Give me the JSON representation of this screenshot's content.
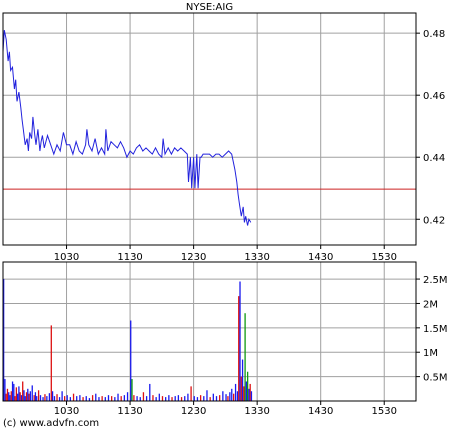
{
  "source": "(c) www.advfn.com",
  "colors": {
    "price_line": "#2222dd",
    "ref_line": "#cc2020",
    "grid": "#a0a0a0",
    "frame": "#000000",
    "vol_up": "#1a1aee",
    "vol_down": "#dd1111",
    "vol_neutral": "#119911"
  },
  "chart_data": [
    {
      "type": "line",
      "title": "NYSE:AIG",
      "x_tick_labels": [
        "1030",
        "1130",
        "1230",
        "1330",
        "1430",
        "1530"
      ],
      "x_ticks": [
        10.5,
        11.5,
        12.5,
        13.5,
        14.5,
        15.5
      ],
      "xlim": [
        9.5,
        16.0
      ],
      "ylim": [
        0.4117,
        0.4865
      ],
      "y_ticks": [
        0.42,
        0.44,
        0.46,
        0.48
      ],
      "y_tick_labels": [
        "0.42",
        "0.44",
        "0.46",
        "0.48"
      ],
      "grid": true,
      "reference_line": 0.4297,
      "series": [
        {
          "x": [
            9.5,
            9.52,
            9.55,
            9.58,
            9.6,
            9.62,
            9.65,
            9.68,
            9.7,
            9.72,
            9.75,
            9.78,
            9.8,
            9.82,
            9.85,
            9.88,
            9.9,
            9.92,
            9.95,
            9.97,
            10.0,
            10.02,
            10.05,
            10.08,
            10.1,
            10.12,
            10.15,
            10.2,
            10.25,
            10.3,
            10.35,
            10.4,
            10.45,
            10.5,
            10.55,
            10.6,
            10.65,
            10.7,
            10.75,
            10.8,
            10.82,
            10.85,
            10.9,
            10.95,
            11.0,
            11.05,
            11.1,
            11.12,
            11.15,
            11.2,
            11.25,
            11.3,
            11.35,
            11.4,
            11.45,
            11.5,
            11.55,
            11.6,
            11.65,
            11.7,
            11.75,
            11.8,
            11.85,
            11.9,
            11.95,
            12.0,
            12.02,
            12.05,
            12.1,
            12.15,
            12.2,
            12.25,
            12.3,
            12.35,
            12.4,
            12.42,
            12.45,
            12.47,
            12.5,
            12.52,
            12.55,
            12.57,
            12.6,
            12.62,
            12.65,
            12.7,
            12.75,
            12.8,
            12.85,
            12.9,
            12.95,
            13.0,
            13.05,
            13.1,
            13.15,
            13.18,
            13.2,
            13.22,
            13.25,
            13.28,
            13.3,
            13.32,
            13.35,
            13.37,
            13.4
          ],
          "y": [
            0.474,
            0.481,
            0.478,
            0.471,
            0.474,
            0.468,
            0.469,
            0.462,
            0.465,
            0.458,
            0.461,
            0.456,
            0.452,
            0.449,
            0.444,
            0.446,
            0.442,
            0.448,
            0.446,
            0.453,
            0.447,
            0.444,
            0.449,
            0.442,
            0.445,
            0.447,
            0.443,
            0.447,
            0.444,
            0.441,
            0.444,
            0.442,
            0.448,
            0.444,
            0.444,
            0.441,
            0.445,
            0.442,
            0.441,
            0.444,
            0.449,
            0.444,
            0.442,
            0.446,
            0.441,
            0.443,
            0.441,
            0.449,
            0.442,
            0.445,
            0.444,
            0.443,
            0.445,
            0.443,
            0.44,
            0.442,
            0.441,
            0.443,
            0.444,
            0.442,
            0.443,
            0.442,
            0.441,
            0.443,
            0.441,
            0.44,
            0.446,
            0.441,
            0.443,
            0.441,
            0.443,
            0.442,
            0.443,
            0.442,
            0.441,
            0.432,
            0.44,
            0.43,
            0.44,
            0.43,
            0.441,
            0.43,
            0.44,
            0.44,
            0.441,
            0.441,
            0.441,
            0.44,
            0.441,
            0.441,
            0.44,
            0.441,
            0.442,
            0.441,
            0.436,
            0.432,
            0.428,
            0.425,
            0.421,
            0.424,
            0.419,
            0.421,
            0.418,
            0.42,
            0.419
          ]
        }
      ]
    },
    {
      "type": "bar",
      "x_tick_labels": [
        "1030",
        "1130",
        "1230",
        "1330",
        "1430",
        "1530"
      ],
      "x_ticks": [
        10.5,
        11.5,
        12.5,
        13.5,
        14.5,
        15.5
      ],
      "xlim": [
        9.5,
        16.0
      ],
      "ylim": [
        0,
        2.85
      ],
      "y_ticks": [
        0.5,
        1.0,
        1.5,
        2.0,
        2.5
      ],
      "y_tick_labels": [
        "0.5M",
        "1M",
        "1.5M",
        "2M",
        "2.5M"
      ],
      "grid": true,
      "bars": [
        {
          "x": 9.5,
          "v": 2.5,
          "c": "vol_up"
        },
        {
          "x": 9.52,
          "v": 0.45,
          "c": "vol_up"
        },
        {
          "x": 9.54,
          "v": 0.15,
          "c": "vol_down"
        },
        {
          "x": 9.56,
          "v": 0.25,
          "c": "vol_down"
        },
        {
          "x": 9.58,
          "v": 0.18,
          "c": "vol_up"
        },
        {
          "x": 9.6,
          "v": 0.12,
          "c": "vol_up"
        },
        {
          "x": 9.62,
          "v": 0.2,
          "c": "vol_down"
        },
        {
          "x": 9.64,
          "v": 0.4,
          "c": "vol_up"
        },
        {
          "x": 9.66,
          "v": 0.35,
          "c": "vol_up"
        },
        {
          "x": 9.68,
          "v": 0.1,
          "c": "vol_down"
        },
        {
          "x": 9.7,
          "v": 0.28,
          "c": "vol_down"
        },
        {
          "x": 9.72,
          "v": 0.15,
          "c": "vol_up"
        },
        {
          "x": 9.74,
          "v": 0.3,
          "c": "vol_up"
        },
        {
          "x": 9.76,
          "v": 0.18,
          "c": "vol_down"
        },
        {
          "x": 9.78,
          "v": 0.12,
          "c": "vol_up"
        },
        {
          "x": 9.8,
          "v": 0.4,
          "c": "vol_down"
        },
        {
          "x": 9.82,
          "v": 0.22,
          "c": "vol_up"
        },
        {
          "x": 9.84,
          "v": 0.1,
          "c": "vol_up"
        },
        {
          "x": 9.86,
          "v": 0.18,
          "c": "vol_down"
        },
        {
          "x": 9.88,
          "v": 0.25,
          "c": "vol_up"
        },
        {
          "x": 9.9,
          "v": 0.15,
          "c": "vol_down"
        },
        {
          "x": 9.92,
          "v": 0.2,
          "c": "vol_up"
        },
        {
          "x": 9.95,
          "v": 0.32,
          "c": "vol_up"
        },
        {
          "x": 9.98,
          "v": 0.12,
          "c": "vol_down"
        },
        {
          "x": 10.0,
          "v": 0.18,
          "c": "vol_up"
        },
        {
          "x": 10.02,
          "v": 0.1,
          "c": "vol_up"
        },
        {
          "x": 10.05,
          "v": 0.22,
          "c": "vol_down"
        },
        {
          "x": 10.08,
          "v": 0.12,
          "c": "vol_up"
        },
        {
          "x": 10.12,
          "v": 0.08,
          "c": "vol_up"
        },
        {
          "x": 10.15,
          "v": 0.14,
          "c": "vol_down"
        },
        {
          "x": 10.18,
          "v": 0.1,
          "c": "vol_up"
        },
        {
          "x": 10.22,
          "v": 0.16,
          "c": "vol_up"
        },
        {
          "x": 10.25,
          "v": 1.55,
          "c": "vol_down"
        },
        {
          "x": 10.27,
          "v": 0.2,
          "c": "vol_up"
        },
        {
          "x": 10.3,
          "v": 0.1,
          "c": "vol_up"
        },
        {
          "x": 10.34,
          "v": 0.14,
          "c": "vol_down"
        },
        {
          "x": 10.38,
          "v": 0.08,
          "c": "vol_up"
        },
        {
          "x": 10.42,
          "v": 0.2,
          "c": "vol_up"
        },
        {
          "x": 10.46,
          "v": 0.1,
          "c": "vol_down"
        },
        {
          "x": 10.5,
          "v": 0.12,
          "c": "vol_up"
        },
        {
          "x": 10.55,
          "v": 0.08,
          "c": "vol_up"
        },
        {
          "x": 10.6,
          "v": 0.15,
          "c": "vol_down"
        },
        {
          "x": 10.65,
          "v": 0.1,
          "c": "vol_up"
        },
        {
          "x": 10.7,
          "v": 0.12,
          "c": "vol_up"
        },
        {
          "x": 10.75,
          "v": 0.08,
          "c": "vol_down"
        },
        {
          "x": 10.8,
          "v": 0.1,
          "c": "vol_up"
        },
        {
          "x": 10.85,
          "v": 0.06,
          "c": "vol_up"
        },
        {
          "x": 10.9,
          "v": 0.12,
          "c": "vol_down"
        },
        {
          "x": 10.95,
          "v": 0.15,
          "c": "vol_up"
        },
        {
          "x": 11.0,
          "v": 0.08,
          "c": "vol_up"
        },
        {
          "x": 11.05,
          "v": 0.1,
          "c": "vol_down"
        },
        {
          "x": 11.1,
          "v": 0.08,
          "c": "vol_up"
        },
        {
          "x": 11.15,
          "v": 0.12,
          "c": "vol_up"
        },
        {
          "x": 11.2,
          "v": 0.1,
          "c": "vol_down"
        },
        {
          "x": 11.25,
          "v": 0.08,
          "c": "vol_up"
        },
        {
          "x": 11.3,
          "v": 0.15,
          "c": "vol_up"
        },
        {
          "x": 11.35,
          "v": 0.1,
          "c": "vol_down"
        },
        {
          "x": 11.4,
          "v": 0.12,
          "c": "vol_up"
        },
        {
          "x": 11.45,
          "v": 0.18,
          "c": "vol_up"
        },
        {
          "x": 11.5,
          "v": 1.65,
          "c": "vol_up"
        },
        {
          "x": 11.52,
          "v": 0.45,
          "c": "vol_neutral"
        },
        {
          "x": 11.55,
          "v": 0.12,
          "c": "vol_down"
        },
        {
          "x": 11.6,
          "v": 0.1,
          "c": "vol_up"
        },
        {
          "x": 11.65,
          "v": 0.08,
          "c": "vol_up"
        },
        {
          "x": 11.7,
          "v": 0.18,
          "c": "vol_down"
        },
        {
          "x": 11.75,
          "v": 0.1,
          "c": "vol_up"
        },
        {
          "x": 11.8,
          "v": 0.35,
          "c": "vol_up"
        },
        {
          "x": 11.85,
          "v": 0.12,
          "c": "vol_down"
        },
        {
          "x": 11.9,
          "v": 0.08,
          "c": "vol_up"
        },
        {
          "x": 11.95,
          "v": 0.15,
          "c": "vol_up"
        },
        {
          "x": 12.0,
          "v": 0.1,
          "c": "vol_down"
        },
        {
          "x": 12.05,
          "v": 0.08,
          "c": "vol_up"
        },
        {
          "x": 12.1,
          "v": 0.12,
          "c": "vol_up"
        },
        {
          "x": 12.15,
          "v": 0.08,
          "c": "vol_down"
        },
        {
          "x": 12.2,
          "v": 0.1,
          "c": "vol_up"
        },
        {
          "x": 12.25,
          "v": 0.12,
          "c": "vol_up"
        },
        {
          "x": 12.3,
          "v": 0.08,
          "c": "vol_down"
        },
        {
          "x": 12.35,
          "v": 0.1,
          "c": "vol_up"
        },
        {
          "x": 12.4,
          "v": 0.15,
          "c": "vol_up"
        },
        {
          "x": 12.45,
          "v": 0.3,
          "c": "vol_down"
        },
        {
          "x": 12.5,
          "v": 0.1,
          "c": "vol_up"
        },
        {
          "x": 12.55,
          "v": 0.08,
          "c": "vol_up"
        },
        {
          "x": 12.6,
          "v": 0.12,
          "c": "vol_down"
        },
        {
          "x": 12.65,
          "v": 0.1,
          "c": "vol_up"
        },
        {
          "x": 12.7,
          "v": 0.22,
          "c": "vol_up"
        },
        {
          "x": 12.75,
          "v": 0.08,
          "c": "vol_down"
        },
        {
          "x": 12.8,
          "v": 0.15,
          "c": "vol_up"
        },
        {
          "x": 12.85,
          "v": 0.1,
          "c": "vol_up"
        },
        {
          "x": 12.9,
          "v": 0.12,
          "c": "vol_down"
        },
        {
          "x": 12.95,
          "v": 0.2,
          "c": "vol_up"
        },
        {
          "x": 13.0,
          "v": 0.14,
          "c": "vol_up"
        },
        {
          "x": 13.03,
          "v": 0.1,
          "c": "vol_down"
        },
        {
          "x": 13.06,
          "v": 0.18,
          "c": "vol_up"
        },
        {
          "x": 13.09,
          "v": 0.25,
          "c": "vol_up"
        },
        {
          "x": 13.12,
          "v": 0.15,
          "c": "vol_down"
        },
        {
          "x": 13.15,
          "v": 0.35,
          "c": "vol_up"
        },
        {
          "x": 13.18,
          "v": 0.2,
          "c": "vol_up"
        },
        {
          "x": 13.2,
          "v": 2.15,
          "c": "vol_down"
        },
        {
          "x": 13.22,
          "v": 2.45,
          "c": "vol_up"
        },
        {
          "x": 13.24,
          "v": 0.5,
          "c": "vol_down"
        },
        {
          "x": 13.26,
          "v": 0.85,
          "c": "vol_up"
        },
        {
          "x": 13.28,
          "v": 0.3,
          "c": "vol_down"
        },
        {
          "x": 13.3,
          "v": 1.8,
          "c": "vol_neutral"
        },
        {
          "x": 13.32,
          "v": 0.4,
          "c": "vol_up"
        },
        {
          "x": 13.34,
          "v": 0.6,
          "c": "vol_neutral"
        },
        {
          "x": 13.36,
          "v": 0.25,
          "c": "vol_up"
        },
        {
          "x": 13.38,
          "v": 0.35,
          "c": "vol_down"
        },
        {
          "x": 13.4,
          "v": 0.2,
          "c": "vol_up"
        }
      ]
    }
  ]
}
